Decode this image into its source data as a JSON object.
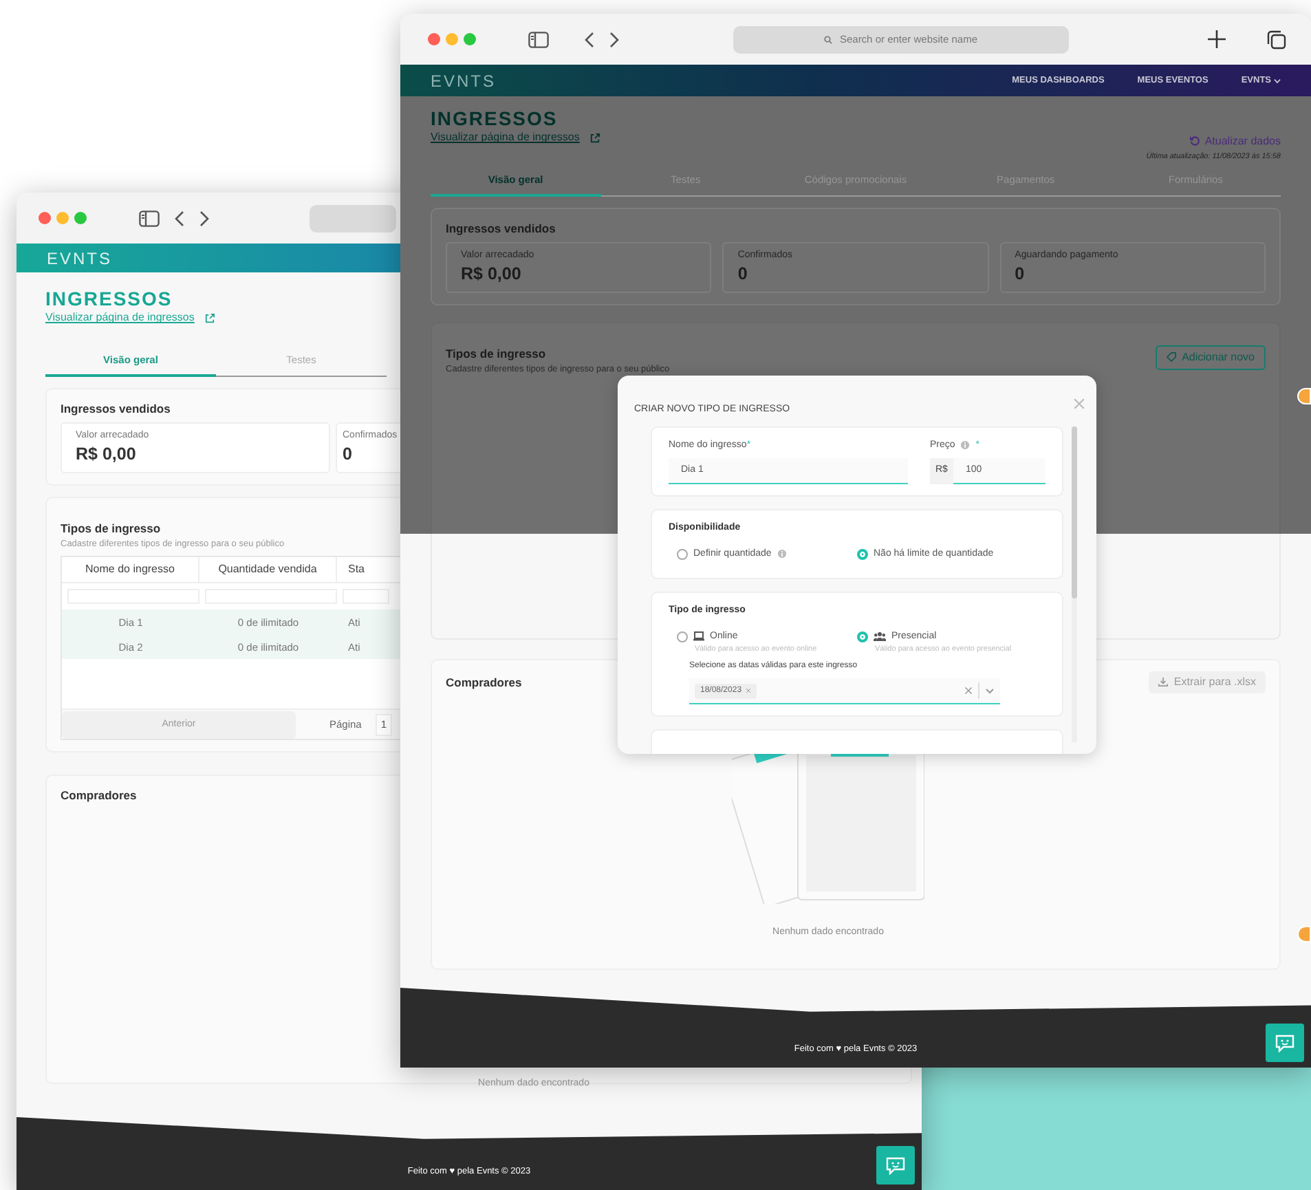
{
  "background_window": {
    "nav": {
      "brand": "EVNTS"
    },
    "header": {
      "title": "INGRESSOS",
      "link": "Visualizar página de ingressos"
    },
    "tabs": [
      {
        "label": "Visão geral",
        "selected": true
      },
      {
        "label": "Testes",
        "selected": false
      }
    ],
    "sold_tickets": {
      "title": "Ingressos vendidos",
      "stats": [
        {
          "label": "Valor arrecadado",
          "value": "R$ 0,00"
        },
        {
          "label": "Confirmados",
          "value": "0"
        }
      ]
    },
    "ticket_types": {
      "title": "Tipos de ingresso",
      "subtitle": "Cadastre diferentes tipos de ingresso para o seu público",
      "table": {
        "columns": [
          "Nome do ingresso",
          "Quantidade vendida",
          "Sta"
        ],
        "rows": [
          {
            "cells": [
              "Dia 1",
              "0 de ilimitado",
              "Ati"
            ]
          },
          {
            "cells": [
              "Dia 2",
              "0 de ilimitado",
              "Ati"
            ]
          }
        ]
      },
      "pagination": {
        "previous": {
          "label": "Anterior",
          "disabled": true
        },
        "page_label": "Página",
        "page": "1"
      }
    },
    "buyers": {
      "title": "Compradores",
      "empty_text": "Nenhum dado encontrado"
    },
    "footer": "Feito com ♥ pela Evnts © 2023"
  },
  "front_window": {
    "search": {
      "placeholder": "Search or enter website name"
    },
    "nav": {
      "brand": "EVNTS",
      "items": [
        {
          "label": "MEUS DASHBOARDS",
          "caret": false
        },
        {
          "label": "MEUS EVENTOS",
          "caret": false
        },
        {
          "label": "EVNTS",
          "caret": true
        }
      ]
    },
    "header": {
      "title": "INGRESSOS",
      "link": "Visualizar página de ingressos",
      "refresh": "Atualizar dados",
      "last_update": "Última atualização: 11/08/2023 às 15:58"
    },
    "tabs": [
      {
        "label": "Visão geral",
        "selected": true
      },
      {
        "label": "Testes",
        "selected": false
      },
      {
        "label": "Códigos promocionais",
        "selected": false
      },
      {
        "label": "Pagamentos",
        "selected": false
      },
      {
        "label": "Formulários",
        "selected": false
      }
    ],
    "sold_tickets": {
      "title": "Ingressos vendidos",
      "stats": [
        {
          "label": "Valor arrecadado",
          "value": "R$ 0,00"
        },
        {
          "label": "Confirmados",
          "value": "0"
        },
        {
          "label": "Aguardando pagamento",
          "value": "0"
        }
      ]
    },
    "ticket_types": {
      "title": "Tipos de ingresso",
      "subtitle": "Cadastre diferentes tipos de ingresso para o seu público",
      "add_button": "Adicionar novo"
    },
    "buyers": {
      "title": "Compradores",
      "export_button": {
        "label": "Extrair para .xlsx",
        "disabled": true
      },
      "empty_text": "Nenhum dado encontrado"
    },
    "footer": "Feito com ♥ pela Evnts © 2023",
    "modal": {
      "title": "CRIAR NOVO TIPO DE INGRESSO",
      "name_field": {
        "label": "Nome do ingresso",
        "required_mark": "*",
        "value": "Dia 1"
      },
      "price_field": {
        "label": "Preço",
        "required_mark": "*",
        "prefix": "R$",
        "value": "100"
      },
      "availability": {
        "title": "Disponibilidade",
        "options": [
          {
            "label": "Definir quantidade",
            "info": true,
            "selected": false
          },
          {
            "label": "Não há limite de quantidade",
            "info": false,
            "selected": true
          }
        ]
      },
      "ticket_type": {
        "title": "Tipo de ingresso",
        "options": [
          {
            "kind": "online",
            "label": "Online",
            "hint": "Válido para acesso ao evento online",
            "selected": false
          },
          {
            "kind": "presencial",
            "label": "Presencial",
            "hint": "Válido para acesso ao evento presencial",
            "selected": true
          }
        ],
        "dates_label": "Selecione as datas válidas para este ingresso",
        "dates": [
          "18/08/2023"
        ]
      }
    }
  }
}
